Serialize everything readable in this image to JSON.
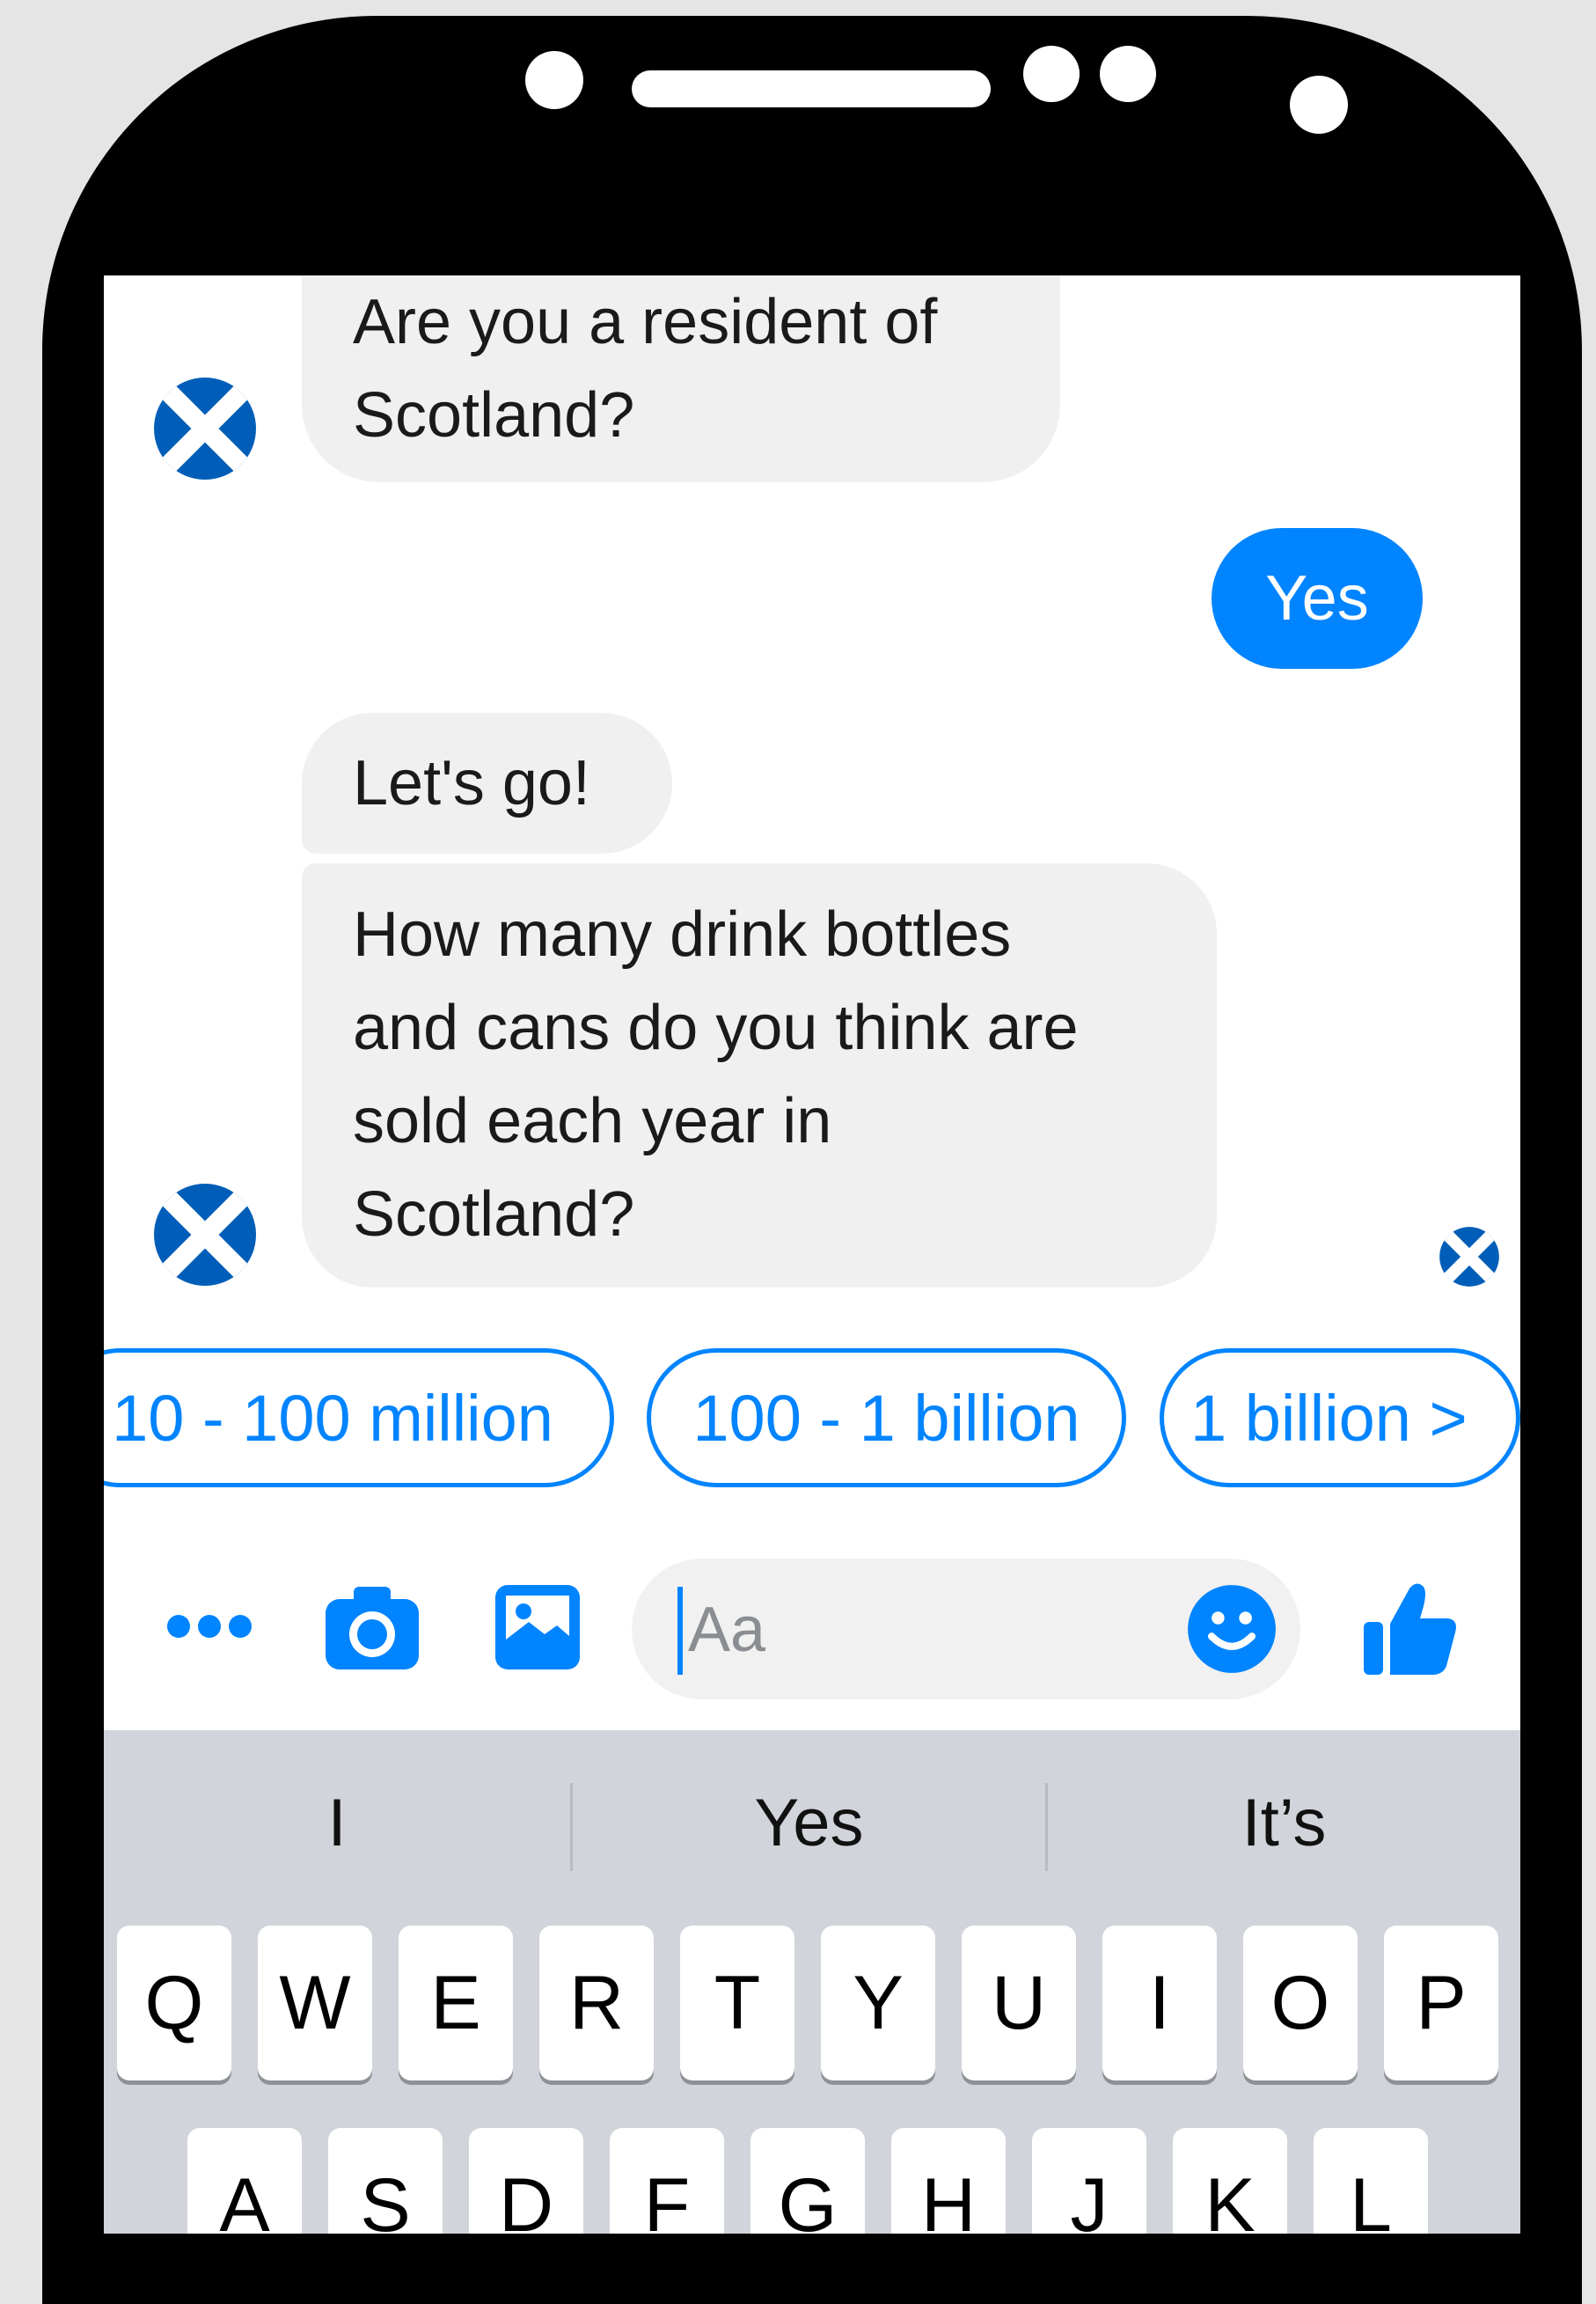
{
  "device": {
    "frame_color": "#000000"
  },
  "colors": {
    "accent": "#0084ff",
    "bubble_in": "#f0f0f0",
    "keyboard_bg": "#d1d4da"
  },
  "chat": {
    "messages": [
      {
        "sender": "bot",
        "lines": [
          "Are you a resident of",
          "Scotland?"
        ]
      },
      {
        "sender": "user",
        "text": "Yes"
      },
      {
        "sender": "bot",
        "lines": [
          "Let's go!"
        ]
      },
      {
        "sender": "bot",
        "lines": [
          "How many drink bottles",
          "and cans do you think are",
          "sold each year in",
          "Scotland?"
        ]
      }
    ],
    "bot_avatar_icon": "scotland-flag-icon",
    "read_receipt_icon": "scotland-flag-icon"
  },
  "quick_replies": [
    "10 - 100 million",
    "100 - 1 billion",
    "1 billion >"
  ],
  "composer": {
    "placeholder": "Aa",
    "icons": [
      "more-icon",
      "camera-icon",
      "image-icon",
      "emoji-icon",
      "thumbs-up-icon"
    ]
  },
  "keyboard": {
    "suggestions": [
      "I",
      "Yes",
      "It’s"
    ],
    "row1": [
      "Q",
      "W",
      "E",
      "R",
      "T",
      "Y",
      "U",
      "I",
      "O",
      "P"
    ],
    "row2": [
      "A",
      "S",
      "D",
      "F",
      "G",
      "H",
      "J",
      "K",
      "L"
    ]
  }
}
